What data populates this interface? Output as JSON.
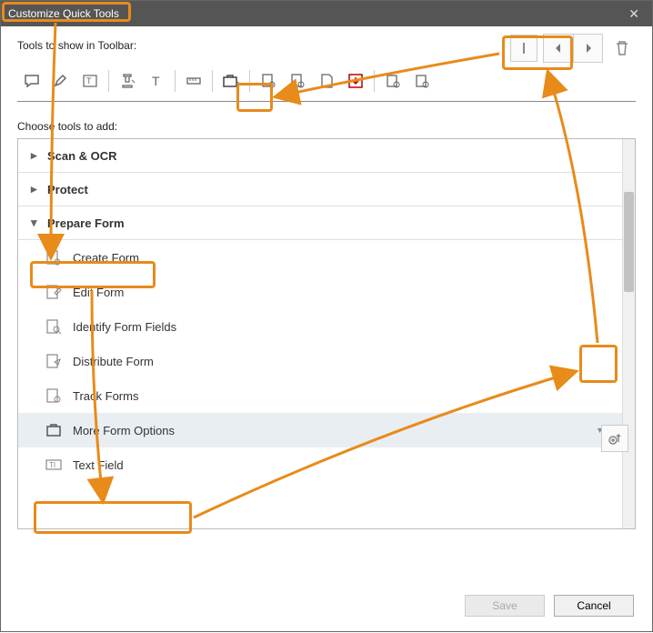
{
  "title": "Customize Quick Tools",
  "tools_show_label": "Tools to show in Toolbar:",
  "choose_label": "Choose tools to add:",
  "sections": {
    "scan_ocr": "Scan & OCR",
    "protect": "Protect",
    "prepare_form": "Prepare Form"
  },
  "items": {
    "create_form": "Create Form",
    "edit_form": "Edit Form",
    "identify": "Identify Form Fields",
    "distribute": "Distribute Form",
    "track": "Track Forms",
    "more_options": "More Form Options",
    "text_field": "Text Field"
  },
  "buttons": {
    "save": "Save",
    "cancel": "Cancel"
  }
}
